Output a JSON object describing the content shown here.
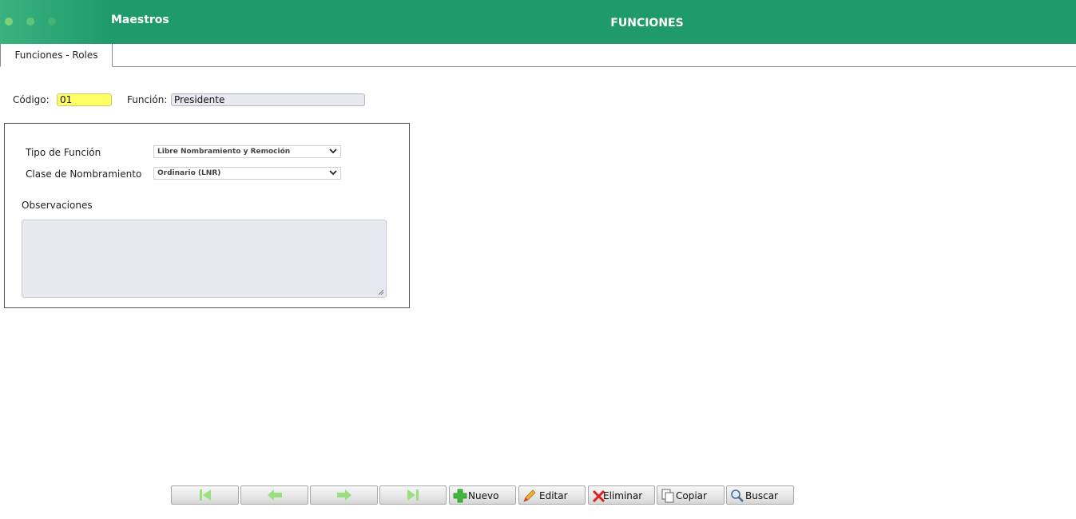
{
  "header": {
    "module": "Maestros",
    "title": "FUNCIONES"
  },
  "tabs": [
    {
      "label": "Funciones - Roles",
      "active": true
    }
  ],
  "form": {
    "codigo_label": "Código:",
    "codigo_value": "01",
    "funcion_label": "Función:",
    "funcion_value": "Presidente",
    "tipo_label": "Tipo de Función",
    "tipo_value": "Libre Nombramiento y Remoción",
    "clase_label": "Clase de Nombramiento",
    "clase_value": "Ordinario (LNR)",
    "observaciones_label": "Observaciones",
    "observaciones_value": ""
  },
  "toolbar": {
    "nuevo": "Nuevo",
    "editar": "Editar",
    "eliminar": "Eliminar",
    "copiar": "Copiar",
    "buscar": "Buscar",
    "nav_icons": [
      "first-record-icon",
      "previous-record-icon",
      "next-record-icon",
      "last-record-icon"
    ]
  },
  "colors": {
    "header": "#1f9b6b",
    "code_field": "#ffff66",
    "readonly_field": "#e8e8f0",
    "nav_arrows": "#9be07e"
  }
}
